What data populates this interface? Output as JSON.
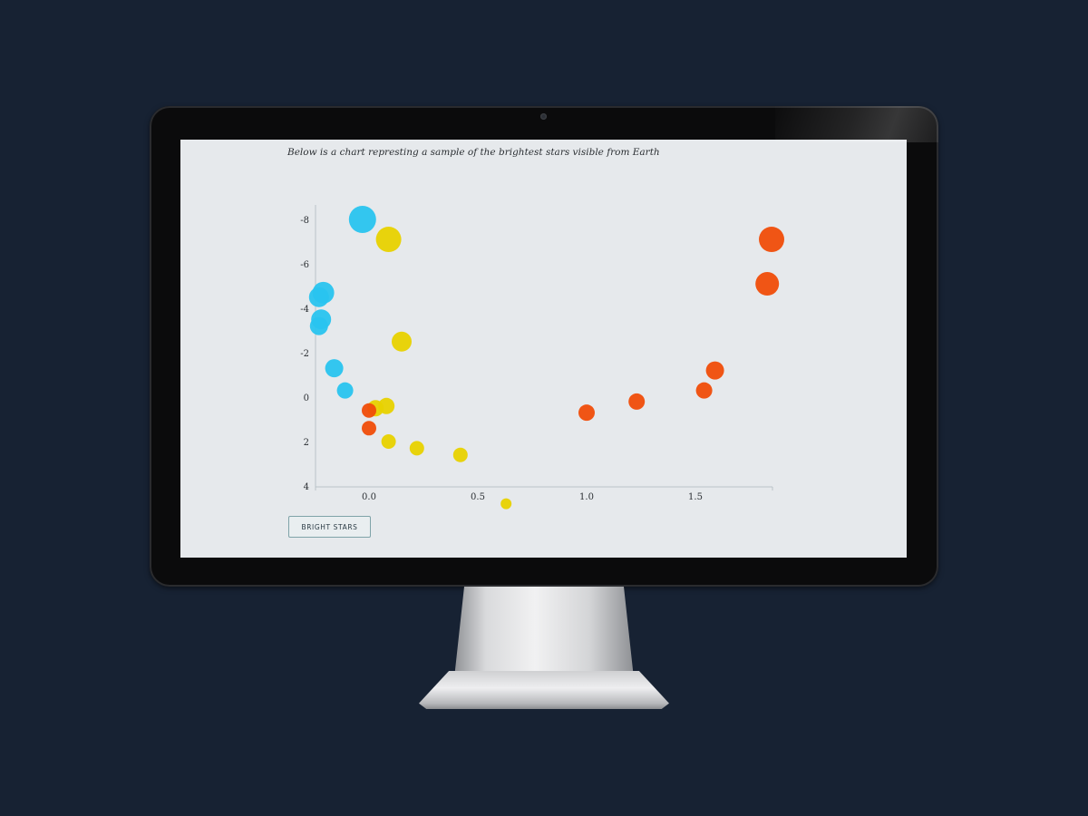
{
  "screen": {
    "intro_text": "Below is a chart represting a sample of the brightest stars visible from Earth",
    "button_label": "BRIGHT STARS"
  },
  "colors": {
    "background": "#172233",
    "screen": "#e6e9ec",
    "blue": "#29c4ef",
    "yellow": "#e8d200",
    "red": "#f04d0a"
  },
  "chart_data": {
    "type": "scatter",
    "xlim": [
      -0.25,
      1.85
    ],
    "ylim": [
      -8.5,
      5
    ],
    "y_inverted": true,
    "x_ticks": [
      "0.0",
      "0.5",
      "1.0",
      "1.5"
    ],
    "x_tick_values": [
      0.0,
      0.5,
      1.0,
      1.5
    ],
    "y_ticks": [
      "-8",
      "-6",
      "-4",
      "-2",
      "0",
      "2",
      "4"
    ],
    "y_tick_values": [
      -8,
      -6,
      -4,
      -2,
      0,
      2,
      4
    ],
    "series": [
      {
        "color": "blue",
        "points": [
          {
            "x": -0.03,
            "y": -8.0,
            "size": 15
          },
          {
            "x": -0.21,
            "y": -4.7,
            "size": 12
          },
          {
            "x": -0.23,
            "y": -4.5,
            "size": 11
          },
          {
            "x": -0.22,
            "y": -3.5,
            "size": 11
          },
          {
            "x": -0.23,
            "y": -3.2,
            "size": 10
          },
          {
            "x": -0.16,
            "y": -1.3,
            "size": 10
          },
          {
            "x": -0.11,
            "y": -0.3,
            "size": 9
          }
        ]
      },
      {
        "color": "yellow",
        "points": [
          {
            "x": 0.09,
            "y": -7.1,
            "size": 14
          },
          {
            "x": 0.15,
            "y": -2.5,
            "size": 11
          },
          {
            "x": 0.03,
            "y": 0.5,
            "size": 9
          },
          {
            "x": 0.08,
            "y": 0.4,
            "size": 9
          },
          {
            "x": 0.09,
            "y": 2.0,
            "size": 8
          },
          {
            "x": 0.22,
            "y": 2.3,
            "size": 8
          },
          {
            "x": 0.42,
            "y": 2.6,
            "size": 8
          },
          {
            "x": 0.63,
            "y": 4.8,
            "size": 6
          }
        ]
      },
      {
        "color": "red",
        "points": [
          {
            "x": 1.85,
            "y": -7.1,
            "size": 14
          },
          {
            "x": 1.83,
            "y": -5.1,
            "size": 13
          },
          {
            "x": 1.59,
            "y": -1.2,
            "size": 10
          },
          {
            "x": 1.54,
            "y": -0.3,
            "size": 9
          },
          {
            "x": 1.23,
            "y": 0.2,
            "size": 9
          },
          {
            "x": 1.0,
            "y": 0.7,
            "size": 9
          },
          {
            "x": 0.0,
            "y": 0.6,
            "size": 8
          },
          {
            "x": 0.0,
            "y": 1.4,
            "size": 8
          }
        ]
      }
    ]
  }
}
